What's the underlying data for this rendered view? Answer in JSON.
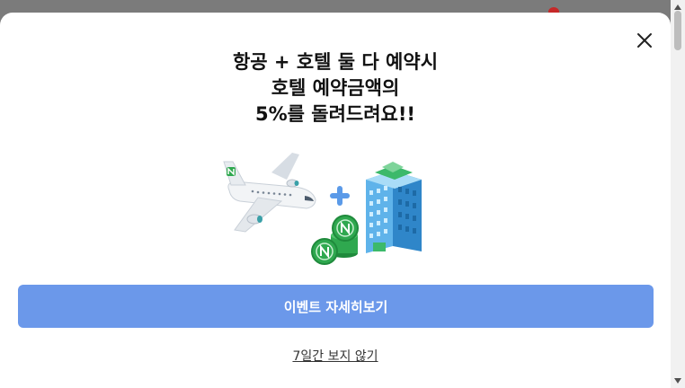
{
  "modal": {
    "headline": [
      "항공 + 호텔 둘 다 예약시",
      "호텔 예약금액의",
      "5%를 돌려드려요!!"
    ],
    "illustration_icons": [
      "airplane-icon",
      "plus-icon",
      "coin-stack-icon",
      "hotel-building-icon"
    ],
    "cta_label": "이벤트 자세히보기",
    "hide_label": "7일간 보지 않기",
    "close_icon": "close-icon"
  },
  "colors": {
    "cta": "#6b98ea",
    "overlay": "#7b7b7b",
    "plus": "#5b9ae8",
    "coin": "#2fa84f",
    "building": "#3f95d6"
  }
}
